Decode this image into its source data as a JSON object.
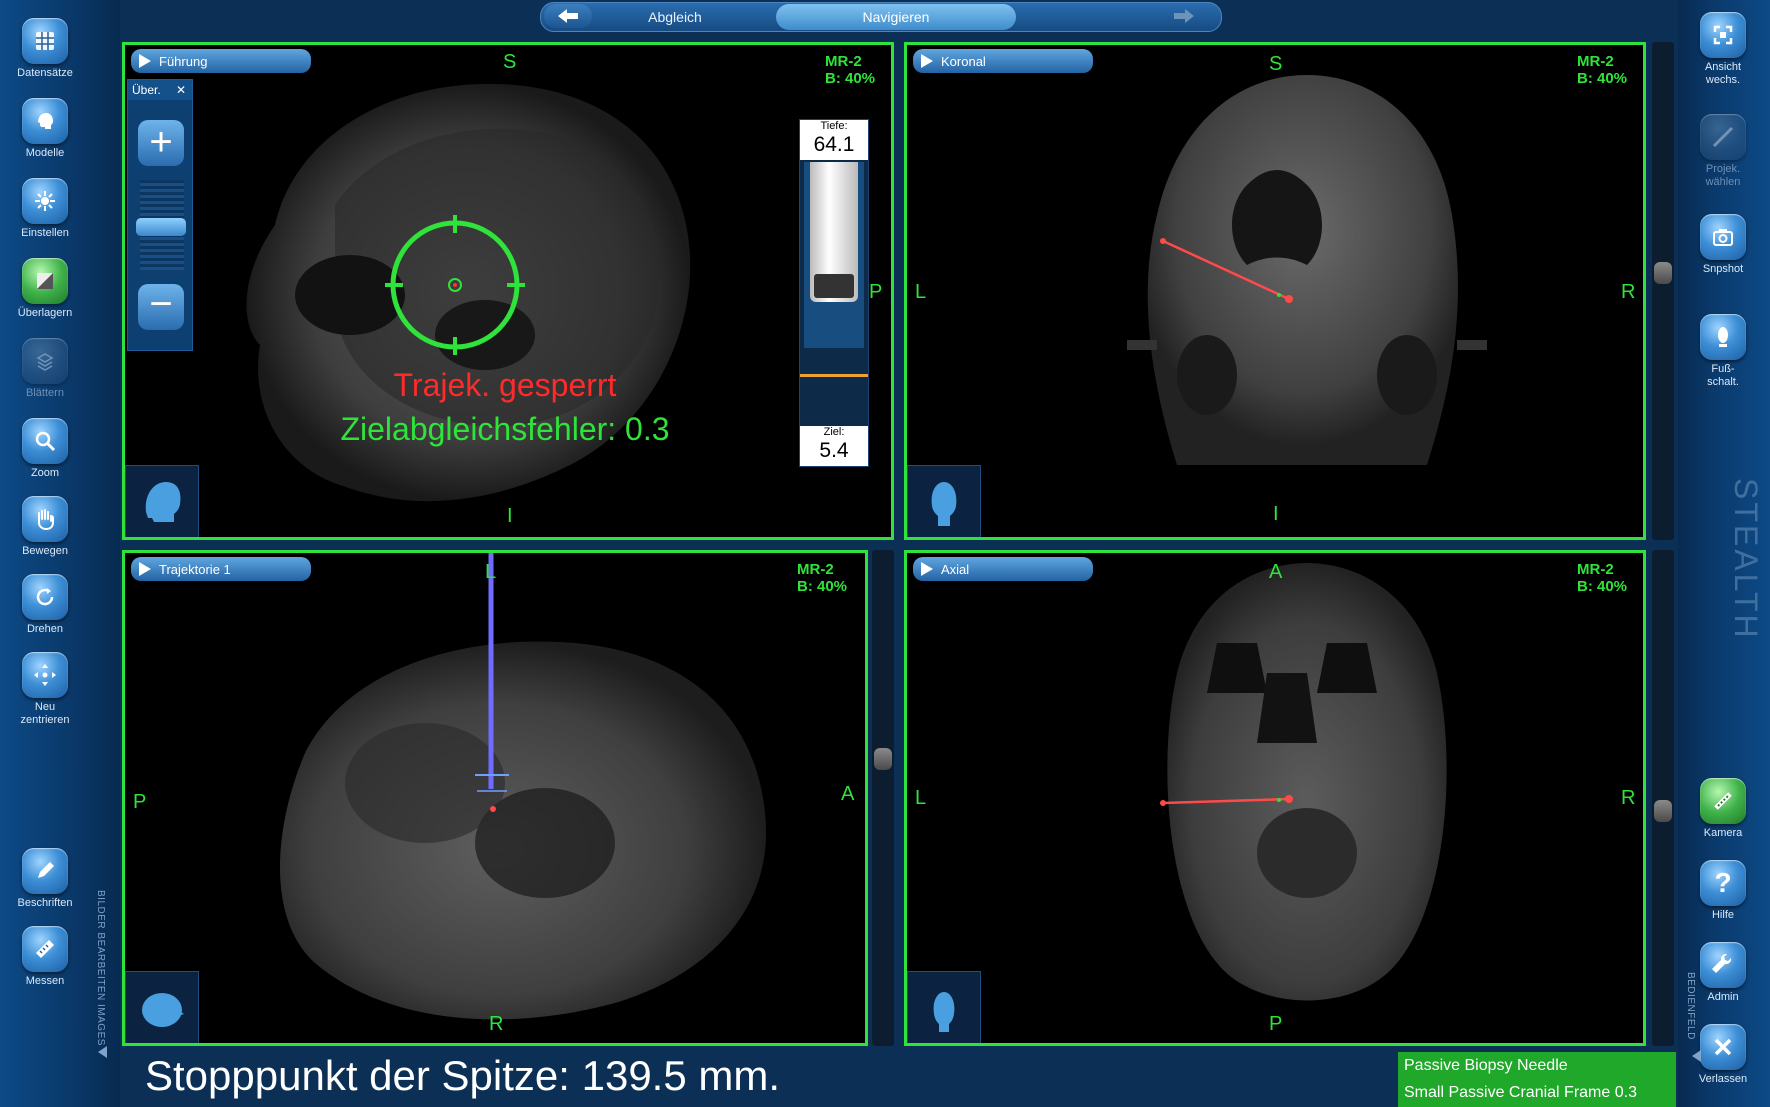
{
  "nav": {
    "back_icon": "arrow-left-icon",
    "forward_icon": "arrow-right-icon",
    "tabs": [
      {
        "label": "Abgleich",
        "active": false
      },
      {
        "label": "Navigieren",
        "active": true
      }
    ]
  },
  "left_toolbar": {
    "items": [
      {
        "label": "Datensätze",
        "icon": "dataset-grid-icon"
      },
      {
        "label": "Modelle",
        "icon": "head-model-icon"
      },
      {
        "label": "Einstellen",
        "icon": "brightness-icon"
      },
      {
        "label": "Überlagern",
        "icon": "overlay-icon",
        "active": true
      },
      {
        "label": "Blättern",
        "icon": "page-stack-icon",
        "disabled": true
      },
      {
        "label": "Zoom",
        "icon": "magnifier-icon"
      },
      {
        "label": "Bewegen",
        "icon": "hand-icon"
      },
      {
        "label": "Drehen",
        "icon": "rotate-icon"
      },
      {
        "label": "Neu zentrieren",
        "icon": "recenter-icon"
      },
      {
        "label": "Beschriften",
        "icon": "pencil-icon"
      },
      {
        "label": "Messen",
        "icon": "ruler-icon"
      }
    ],
    "vertical_label": "BILDER BEARBEITEN IMAGES"
  },
  "right_toolbar": {
    "items": [
      {
        "label": "Ansicht wechs.",
        "icon": "view-switch-icon"
      },
      {
        "label": "Projek. wählen",
        "icon": "projection-icon",
        "disabled": true
      },
      {
        "label": "Snpshot",
        "icon": "camera-snapshot-icon"
      },
      {
        "label": "Fuß-schalt.",
        "icon": "footswitch-icon"
      },
      {
        "label": "Kamera",
        "icon": "tracking-camera-icon",
        "active": true
      },
      {
        "label": "Hilfe",
        "icon": "help-icon"
      },
      {
        "label": "Admin",
        "icon": "wrench-icon"
      },
      {
        "label": "Verlassen",
        "icon": "close-icon"
      }
    ],
    "brand": "STEALTH",
    "vertical_label": "BEDIENFELD"
  },
  "viewports": {
    "guidance": {
      "title": "Führung",
      "dataset": "MR-2",
      "blend": "B: 40%",
      "orient_top": "S",
      "orient_right": "P",
      "orient_bottom": "I",
      "zoom_panel_title": "Über.",
      "trajectory_locked": "Trajek. gesperrt",
      "target_error": "Zielabgleichsfehler: 0.3",
      "depth_label": "Tiefe:",
      "depth_value": "64.1",
      "target_label": "Ziel:",
      "target_value": "5.4",
      "depth_fill_fraction": 0.75
    },
    "coronal": {
      "title": "Koronal",
      "dataset": "MR-2",
      "blend": "B: 40%",
      "orient_top": "S",
      "orient_left": "L",
      "orient_right": "R",
      "orient_bottom": "I"
    },
    "trajectory": {
      "title": "Trajektorie 1",
      "dataset": "MR-2",
      "blend": "B: 40%",
      "orient_top": "L",
      "orient_left": "P",
      "orient_right": "A",
      "orient_bottom": "R"
    },
    "axial": {
      "title": "Axial",
      "dataset": "MR-2",
      "blend": "B: 40%",
      "orient_top": "A",
      "orient_left": "L",
      "orient_right": "R",
      "orient_bottom": "P"
    }
  },
  "status": {
    "tip_stop": "Stopppunkt der Spitze: 139.5 mm.",
    "instrument": "Passive Biopsy Needle",
    "frame": "Small Passive Cranial Frame 0.3"
  },
  "colors": {
    "viewport_border": "#2fe33a",
    "overlay_green": "#2fe33a",
    "locked_red": "#ff2a2a",
    "trajectory_line": "#ff4a4a",
    "trajectory_probe": "#6f6cff",
    "status_green": "#1fa82a"
  }
}
